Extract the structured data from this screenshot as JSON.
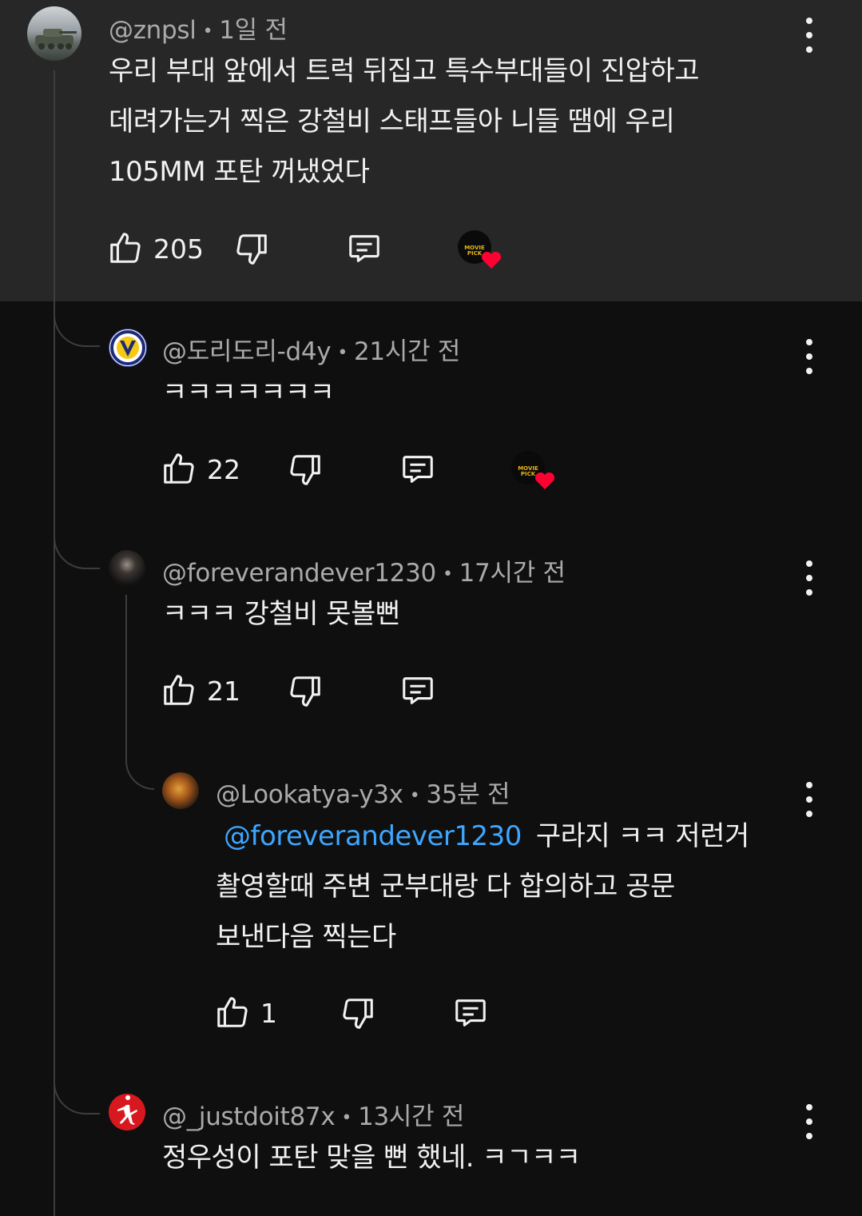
{
  "comments": [
    {
      "handle": "@znpsl",
      "time": "1일 전",
      "lines": [
        "우리 부대 앞에서 트럭 뒤집고 특수부대들이 진압하고",
        "데려가는거 찍은 강철비 스태프들아 니들 땜에 우리",
        "105MM 포탄 꺼냈었다"
      ],
      "likes": "205",
      "creator_heart": true,
      "creator_badge": "MOVIE PICK"
    },
    {
      "handle": "@도리도리-d4y",
      "time": "21시간 전",
      "lines": [
        "ㅋㅋㅋㅋㅋㅋㅋ"
      ],
      "likes": "22",
      "creator_heart": true,
      "creator_badge": "MOVIE PICK"
    },
    {
      "handle": "@foreverandever1230",
      "time": "17시간 전",
      "lines": [
        "ㅋㅋㅋ 강철비 못볼뻔"
      ],
      "likes": "21",
      "creator_heart": false
    },
    {
      "handle": "@Lookatya-y3x",
      "time": "35분 전",
      "mention": "@foreverandever1230",
      "lines": [
        "구라지 ㅋㅋ 저런거",
        "촬영할때 주변 군부대랑 다 합의하고 공문",
        "보낸다음 찍는다"
      ],
      "likes": "1",
      "creator_heart": false
    },
    {
      "handle": "@_justdoit87x",
      "time": "13시간 전",
      "lines": [
        "정우성이 포탄 맞을 뻔 했네. ㅋㄱㅋㅋ"
      ],
      "likes": "",
      "creator_heart": false
    }
  ],
  "separator": "•",
  "colors": {
    "background": "#0f0f0f",
    "highlight": "#272727",
    "mention": "#3ea6ff",
    "heart": "#ff0033",
    "secondary_text": "#aaaaaa"
  },
  "icons": {
    "like": "thumbs-up-icon",
    "dislike": "thumbs-down-icon",
    "reply": "reply-icon",
    "more": "more-vert-icon",
    "heart": "heart-icon"
  }
}
